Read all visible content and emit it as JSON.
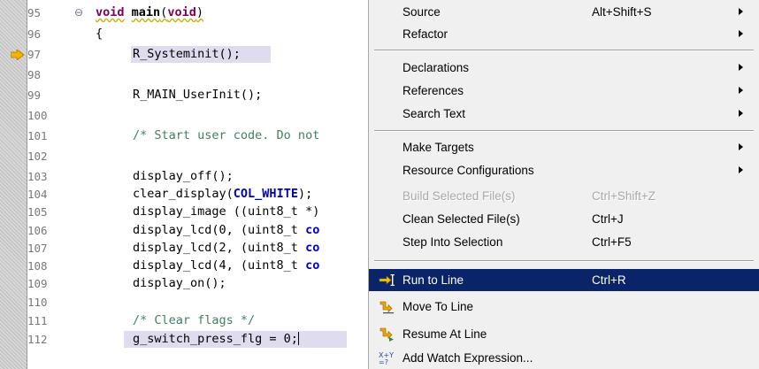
{
  "editor": {
    "lines": [
      {
        "num": "95",
        "text": "void main(void)",
        "kind": "decl"
      },
      {
        "num": "96",
        "text": "{",
        "kind": "plain"
      },
      {
        "num": "97",
        "text": "R_Systeminit();",
        "kind": "current"
      },
      {
        "num": "98",
        "text": "",
        "kind": "plain"
      },
      {
        "num": "99",
        "text": "R_MAIN_UserInit();",
        "kind": "plain"
      },
      {
        "num": "100",
        "text": "",
        "kind": "plain"
      },
      {
        "num": "101",
        "text": "/* Start user code. Do not",
        "kind": "comment"
      },
      {
        "num": "102",
        "text": "",
        "kind": "plain"
      },
      {
        "num": "103",
        "text": "display_off();",
        "kind": "plain"
      },
      {
        "num": "104",
        "text_pre": "clear_display(",
        "text_const": "COL_WHITE",
        "text_post": ");",
        "kind": "const"
      },
      {
        "num": "105",
        "text": "display_image ((uint8_t *)",
        "kind": "plain"
      },
      {
        "num": "106",
        "text_pre": "display_lcd(0, (uint8_t ",
        "text_tail": "co",
        "kind": "tail"
      },
      {
        "num": "107",
        "text_pre": "display_lcd(2, (uint8_t ",
        "text_tail": "co",
        "kind": "tail"
      },
      {
        "num": "108",
        "text_pre": "display_lcd(4, (uint8_t ",
        "text_tail": "co",
        "kind": "tail"
      },
      {
        "num": "109",
        "text": "display_on();",
        "kind": "plain"
      },
      {
        "num": "110",
        "text": "",
        "kind": "plain"
      },
      {
        "num": "111",
        "text": "/* Clear flags */",
        "kind": "comment"
      },
      {
        "num": "112",
        "text": "g_switch_press_flg = 0;",
        "kind": "caret"
      }
    ],
    "decl": {
      "keyword": "void",
      "name": "main",
      "args_open": "(",
      "args_kw": "void",
      "args_close": ")"
    }
  },
  "menu": {
    "items": [
      {
        "label": "Source",
        "accel": "Alt+Shift+S",
        "submenu": true
      },
      {
        "label": "Refactor",
        "accel": "",
        "submenu": true
      },
      {
        "label": "Declarations",
        "accel": "",
        "submenu": true
      },
      {
        "label": "References",
        "accel": "",
        "submenu": true
      },
      {
        "label": "Search Text",
        "accel": "",
        "submenu": true
      },
      {
        "label": "Make Targets",
        "accel": "",
        "submenu": true
      },
      {
        "label": "Resource Configurations",
        "accel": "",
        "submenu": true
      },
      {
        "label": "Build Selected File(s)",
        "accel": "Ctrl+Shift+Z",
        "disabled": true
      },
      {
        "label": "Clean Selected File(s)",
        "accel": "Ctrl+J"
      },
      {
        "label": "Step Into Selection",
        "accel": "Ctrl+F5"
      },
      {
        "label": "Run to Line",
        "accel": "Ctrl+R",
        "selected": true,
        "icon": "run-to-line-icon"
      },
      {
        "label": "Move To Line",
        "accel": "",
        "icon": "move-to-line-icon"
      },
      {
        "label": "Resume At Line",
        "accel": "",
        "icon": "resume-at-line-icon"
      },
      {
        "label": "Add Watch Expression...",
        "accel": "",
        "icon": "add-watch-expression-icon"
      }
    ]
  },
  "colors": {
    "selection": "#0a246a",
    "menu_bg": "#f0f0f0",
    "current_line": "#dedcee",
    "keyword": "#7f0055",
    "comment": "#3f7f5f",
    "constant": "#0000c0"
  }
}
